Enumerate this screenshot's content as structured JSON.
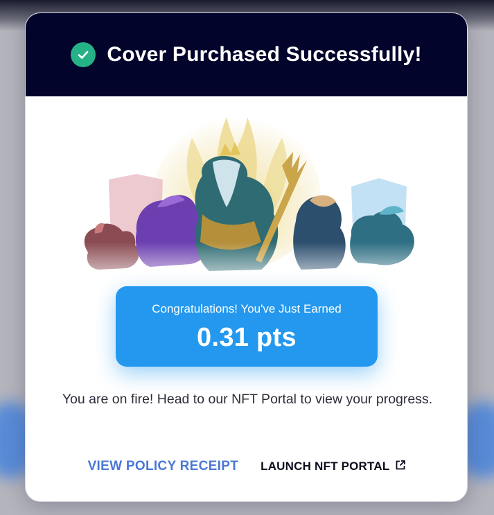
{
  "modal": {
    "title": "Cover Purchased Successfully!",
    "success_icon": "check-circle-icon",
    "colors": {
      "header_bg": "#02042b",
      "success": "#26b287",
      "points_card": "#2398ee",
      "receipt_link": "#4a78d6"
    }
  },
  "reward": {
    "caption": "Congratulations! You've Just Earned",
    "value": "0.31 pts"
  },
  "message": "You are on fire! Head to our NFT Portal to view your progress.",
  "actions": {
    "receipt_label": "VIEW POLICY RECEIPT",
    "portal_label": "LAUNCH NFT PORTAL",
    "portal_icon": "external-link-icon"
  },
  "illustration": {
    "name": "nft-heroes-illustration"
  }
}
